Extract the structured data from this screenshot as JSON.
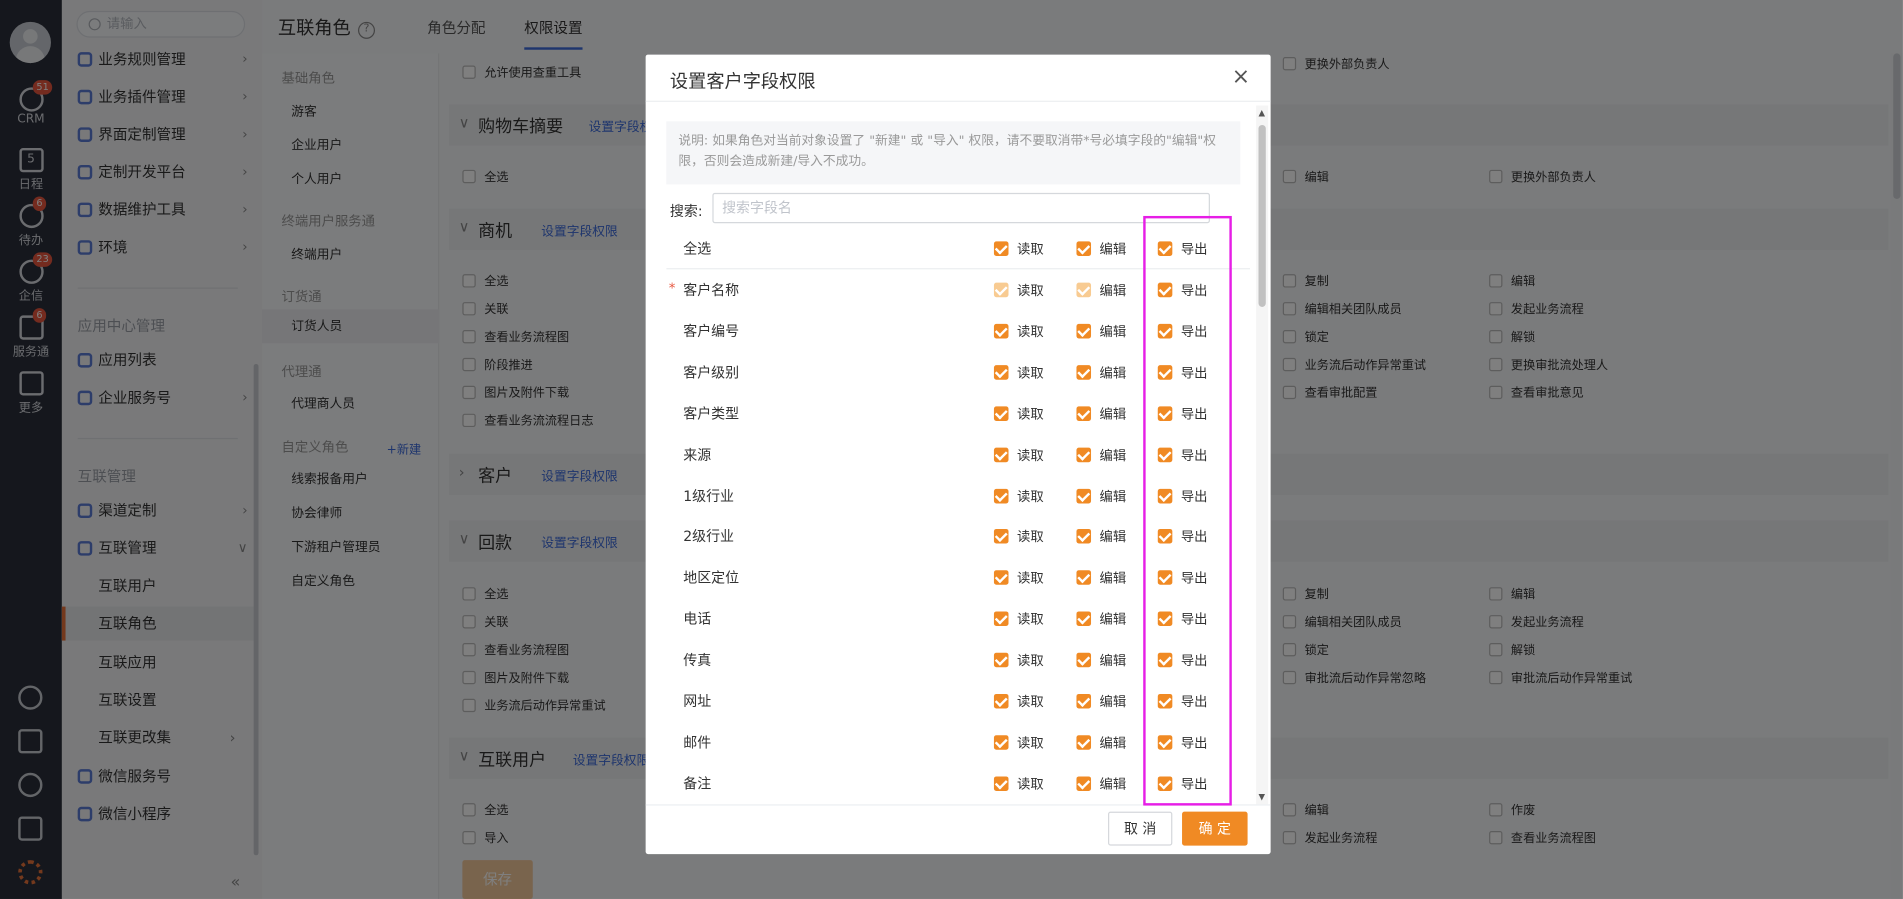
{
  "rail": {
    "items": [
      {
        "label": "CRM",
        "badge": "51"
      },
      {
        "label": "日程",
        "badge": ""
      },
      {
        "label": "待办",
        "badge": "6"
      },
      {
        "label": "企信",
        "badge": "23"
      },
      {
        "label": "服务通",
        "badge": "6"
      },
      {
        "label": "更多",
        "badge": ""
      }
    ],
    "calendar_day": "5"
  },
  "nav": {
    "search_placeholder": "请输入",
    "items_top": [
      {
        "label": "业务规则管理"
      },
      {
        "label": "业务插件管理"
      },
      {
        "label": "界面定制管理"
      },
      {
        "label": "定制开发平台"
      },
      {
        "label": "数据维护工具"
      },
      {
        "label": "环境"
      }
    ],
    "section_app": "应用中心管理",
    "items_app": [
      {
        "label": "应用列表"
      },
      {
        "label": "企业服务号"
      }
    ],
    "section_interconnect": "互联管理",
    "items_inter": [
      {
        "label": "渠道定制"
      },
      {
        "label": "互联管理"
      }
    ],
    "sub_items": [
      {
        "label": "互联用户"
      },
      {
        "label": "互联角色"
      },
      {
        "label": "互联应用"
      },
      {
        "label": "互联设置"
      },
      {
        "label": "互联更改集"
      }
    ],
    "items_bottom": [
      {
        "label": "微信服务号"
      },
      {
        "label": "微信小程序"
      }
    ],
    "collapse": "«"
  },
  "header": {
    "title": "互联角色",
    "help": "?",
    "tabs": [
      {
        "label": "角色分配"
      },
      {
        "label": "权限设置"
      }
    ]
  },
  "roles": {
    "groups": [
      {
        "name": "基础角色",
        "items": [
          "游客",
          "企业用户",
          "个人用户"
        ]
      },
      {
        "name": "终端用户服务通",
        "items": [
          "终端用户"
        ]
      },
      {
        "name": "订货通",
        "items": [
          "订货人员"
        ]
      },
      {
        "name": "代理通",
        "items": [
          "代理商人员"
        ]
      },
      {
        "name": "自定义角色",
        "items": [
          "线索报备用户",
          "协会律师",
          "下游租户管理员",
          "自定义角色"
        ]
      }
    ],
    "new_label": "+新建"
  },
  "main": {
    "top_check": "允许使用查重工具",
    "sections": [
      {
        "title": "购物车摘要",
        "link": "设置字段权限"
      },
      {
        "title": "商机",
        "link": "设置字段权限"
      },
      {
        "title": "客户",
        "link": "设置字段权限"
      },
      {
        "title": "回款",
        "link": "设置字段权限"
      },
      {
        "title": "互联用户",
        "link": "设置字段权限"
      }
    ],
    "chk_cart_left": [
      "全选"
    ],
    "chk_cart_right": [
      "编辑",
      "更换外部负责人"
    ],
    "chk_opp_left": [
      "全选",
      "关联",
      "查看业务流程图",
      "阶段推进",
      "图片及附件下载",
      "查看业务流流程日志"
    ],
    "chk_opp_mid": [
      "复制",
      "编辑相关团队成员",
      "锁定",
      "业务流后动作异常重试",
      "查看审批配置"
    ],
    "chk_opp_right": [
      "编辑",
      "发起业务流程",
      "解锁",
      "更换审批流处理人",
      "查看审批意见"
    ],
    "chk_pay_left": [
      "全选",
      "关联",
      "查看业务流程图",
      "图片及附件下载",
      "业务流后动作异常重试"
    ],
    "chk_pay_mid": [
      "复制",
      "编辑相关团队成员",
      "锁定",
      "审批流后动作异常忽略"
    ],
    "chk_pay_right": [
      "编辑",
      "发起业务流程",
      "解锁",
      "审批流后动作异常重试"
    ],
    "chk_user_left": [
      "全选",
      "导入"
    ],
    "chk_user_mid": [
      "编辑",
      "发起业务流程"
    ],
    "chk_user_right": [
      "作废",
      "查看业务流程图"
    ],
    "save_label": "保存"
  },
  "modal": {
    "title": "设置客户字段权限",
    "close": "×",
    "note": "说明: 如果角色对当前对象设置了 \"新建\" 或 \"导入\" 权限，请不要取消带*号必填字段的\"编辑\"权限，否则会造成新建/导入不成功。",
    "search_label": "搜索:",
    "search_placeholder": "搜索字段名",
    "cols": {
      "read": "读取",
      "edit": "编辑",
      "export": "导出"
    },
    "select_all": "全选",
    "fields": [
      {
        "name": "客户名称",
        "required": true,
        "read_disabled": true,
        "edit_disabled": true
      },
      {
        "name": "客户编号"
      },
      {
        "name": "客户级别"
      },
      {
        "name": "客户类型"
      },
      {
        "name": "来源"
      },
      {
        "name": "1级行业"
      },
      {
        "name": "2级行业"
      },
      {
        "name": "地区定位"
      },
      {
        "name": "电话"
      },
      {
        "name": "传真"
      },
      {
        "name": "网址"
      },
      {
        "name": "邮件"
      },
      {
        "name": "备注"
      }
    ],
    "required_mark": "*",
    "cancel_label": "取 消",
    "ok_label": "确 定"
  },
  "colors": {
    "accent": "#f08a24",
    "link": "#3d6bdb",
    "highlight": "#e61ee6",
    "rail_bg": "#2b2f3a"
  }
}
